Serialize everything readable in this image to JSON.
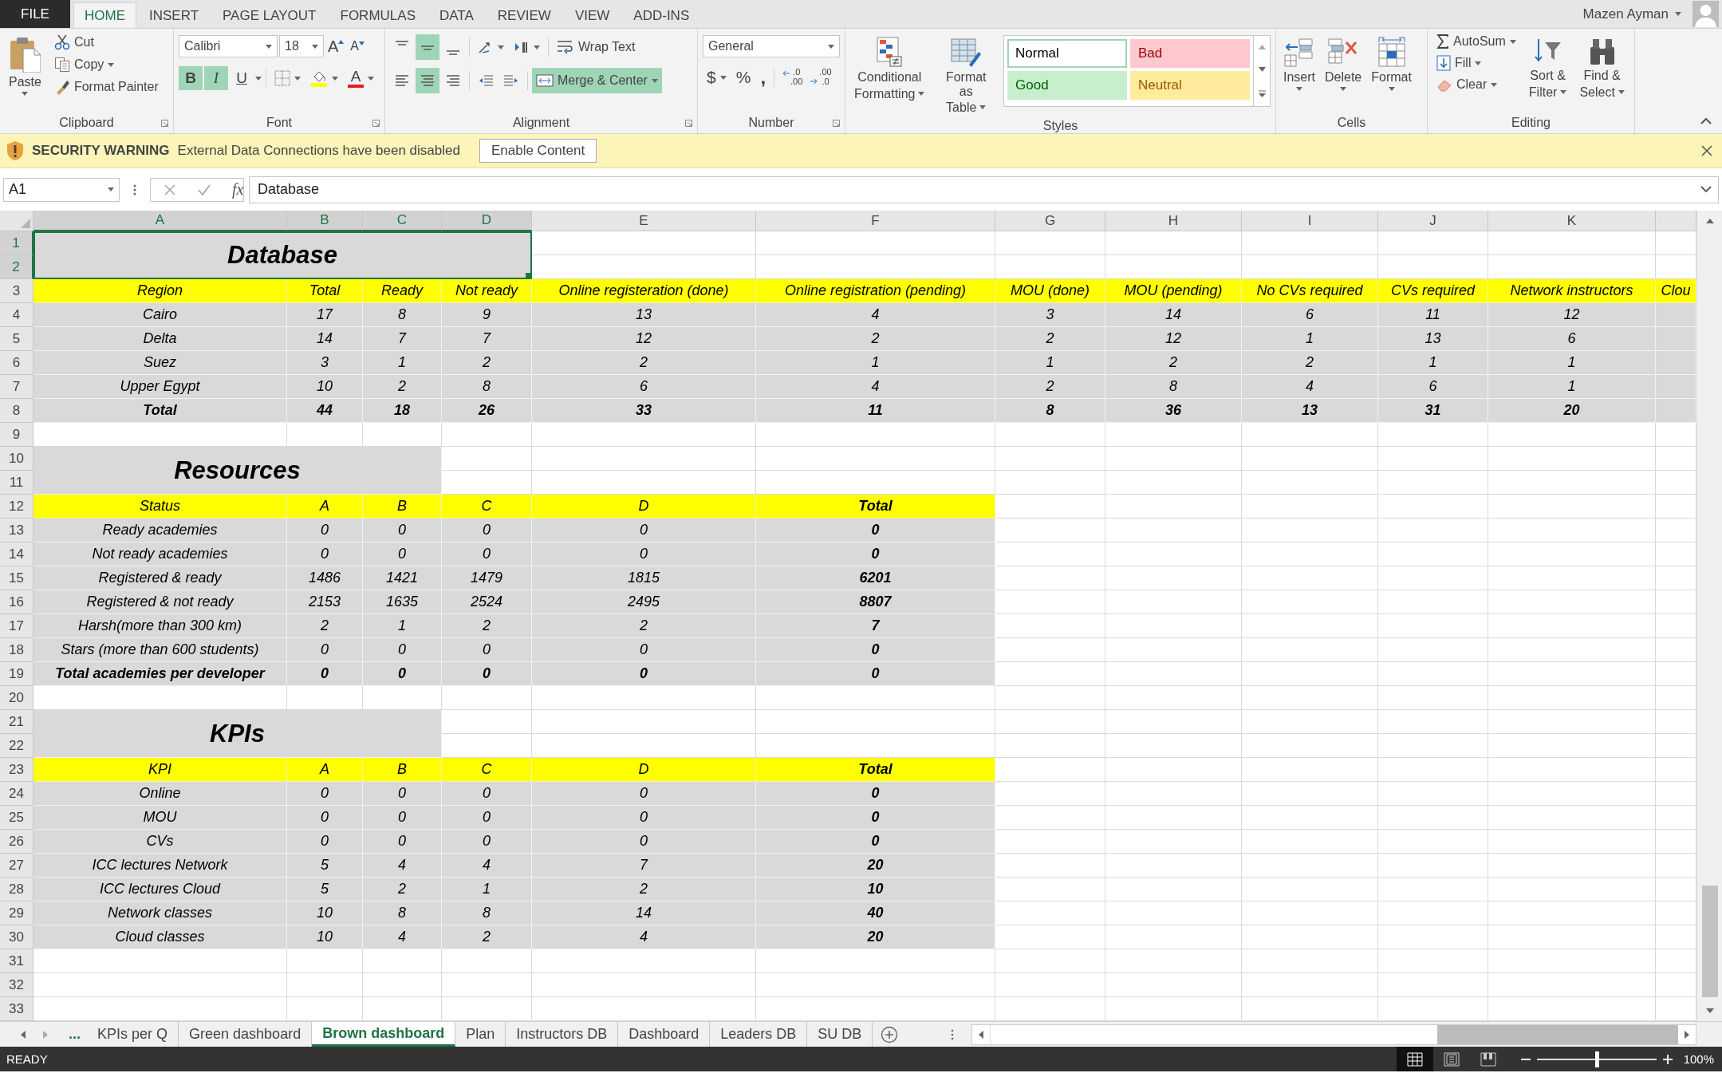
{
  "menu": {
    "file": "FILE",
    "tabs": [
      {
        "label": "HOME",
        "selected": true
      },
      {
        "label": "INSERT",
        "selected": false
      },
      {
        "label": "PAGE LAYOUT",
        "selected": false
      },
      {
        "label": "FORMULAS",
        "selected": false
      },
      {
        "label": "DATA",
        "selected": false
      },
      {
        "label": "REVIEW",
        "selected": false
      },
      {
        "label": "VIEW",
        "selected": false
      },
      {
        "label": "ADD-INS",
        "selected": false
      }
    ],
    "user": "Mazen Ayman"
  },
  "ribbon": {
    "clipboard": {
      "label": "Clipboard",
      "paste": "Paste",
      "cut": "Cut",
      "copy": "Copy",
      "format_painter": "Format Painter"
    },
    "font": {
      "label": "Font",
      "name": "Calibri",
      "size": "18",
      "grow": "A",
      "shrink": "A",
      "color_label": "A",
      "buttons": [
        {
          "kind": "bold",
          "label": "B",
          "on": true
        },
        {
          "kind": "italic",
          "label": "I",
          "on": true
        },
        {
          "kind": "underline",
          "label": "U",
          "on": false
        }
      ]
    },
    "alignment": {
      "label": "Alignment",
      "wrap_text": "Wrap Text",
      "merge_center": "Merge & Center",
      "merged": true,
      "vertical": [
        {
          "selected": false
        },
        {
          "selected": true
        },
        {
          "selected": false
        }
      ],
      "horizontal": [
        {
          "selected": false
        },
        {
          "selected": true
        },
        {
          "selected": false
        }
      ]
    },
    "number": {
      "label": "Number",
      "format": "General",
      "currency": "$",
      "percent": "%",
      "comma": ",",
      "decimals": [
        {
          "kind": "increase",
          "lines": [
            ".0",
            ".00"
          ]
        },
        {
          "kind": "decrease",
          "lines": [
            ".00",
            ".0"
          ]
        }
      ]
    },
    "styles": {
      "label": "Styles",
      "conditional": [
        "Conditional",
        "Formatting"
      ],
      "format_table": [
        "Format as",
        "Table"
      ],
      "gallery": [
        {
          "label": "Normal",
          "kind": "normal",
          "selected": true
        },
        {
          "label": "Bad",
          "kind": "bad",
          "selected": false
        },
        {
          "label": "Good",
          "kind": "good",
          "selected": false
        },
        {
          "label": "Neutral",
          "kind": "neutral",
          "selected": false
        }
      ]
    },
    "cells": {
      "label": "Cells",
      "buttons": [
        {
          "kind": "insert",
          "label": "Insert"
        },
        {
          "kind": "delete",
          "label": "Delete"
        },
        {
          "kind": "format",
          "label": "Format"
        }
      ]
    },
    "editing": {
      "label": "Editing",
      "autosum": "AutoSum",
      "fill": "Fill",
      "clear": "Clear",
      "sort_filter": [
        "Sort &",
        "Filter"
      ],
      "find_select": [
        "Find &",
        "Select"
      ]
    }
  },
  "security": {
    "title": "SECURITY WARNING",
    "message": "External Data Connections have been disabled",
    "button": "Enable Content"
  },
  "formula_bar": {
    "name_box": "A1",
    "fx": "fx",
    "formula": "Database"
  },
  "sheet": {
    "columns": [
      {
        "label": "A",
        "selected": true
      },
      {
        "label": "B",
        "selected": true
      },
      {
        "label": "C",
        "selected": true
      },
      {
        "label": "D",
        "selected": true
      },
      {
        "label": "E",
        "selected": false
      },
      {
        "label": "F",
        "selected": false
      },
      {
        "label": "G",
        "selected": false
      },
      {
        "label": "H",
        "selected": false
      },
      {
        "label": "I",
        "selected": false
      },
      {
        "label": "J",
        "selected": false
      },
      {
        "label": "K",
        "selected": false
      }
    ],
    "rows": [
      {
        "label": "1",
        "selected": true
      },
      {
        "label": "2",
        "selected": true
      },
      {
        "label": "3",
        "selected": false
      },
      {
        "label": "4",
        "selected": false
      },
      {
        "label": "5",
        "selected": false
      },
      {
        "label": "6",
        "selected": false
      },
      {
        "label": "7",
        "selected": false
      },
      {
        "label": "8",
        "selected": false
      },
      {
        "label": "9",
        "selected": false
      },
      {
        "label": "10",
        "selected": false
      },
      {
        "label": "11",
        "selected": false
      },
      {
        "label": "12",
        "selected": false
      },
      {
        "label": "13",
        "selected": false
      },
      {
        "label": "14",
        "selected": false
      },
      {
        "label": "15",
        "selected": false
      },
      {
        "label": "16",
        "selected": false
      },
      {
        "label": "17",
        "selected": false
      },
      {
        "label": "18",
        "selected": false
      },
      {
        "label": "19",
        "selected": false
      },
      {
        "label": "20",
        "selected": false
      },
      {
        "label": "21",
        "selected": false
      },
      {
        "label": "22",
        "selected": false
      },
      {
        "label": "23",
        "selected": false
      },
      {
        "label": "24",
        "selected": false
      },
      {
        "label": "25",
        "selected": false
      },
      {
        "label": "26",
        "selected": false
      },
      {
        "label": "27",
        "selected": false
      },
      {
        "label": "28",
        "selected": false
      },
      {
        "label": "29",
        "selected": false
      },
      {
        "label": "30",
        "selected": false
      },
      {
        "label": "31",
        "selected": false
      },
      {
        "label": "32",
        "selected": false
      },
      {
        "label": "33",
        "selected": false
      }
    ],
    "sections": [
      {
        "title": "Database",
        "total_column": false,
        "header": [
          "Region",
          "Total",
          "Ready",
          "Not ready",
          "Online registeration (done)",
          "Online registration (pending)",
          "MOU (done)",
          "MOU (pending)",
          "No CVs required",
          "CVs required",
          "Network instructors",
          "Clou"
        ],
        "rows": [
          [
            "Cairo",
            "17",
            "8",
            "9",
            "13",
            "4",
            "3",
            "14",
            "6",
            "11",
            "12"
          ],
          [
            "Delta",
            "14",
            "7",
            "7",
            "12",
            "2",
            "2",
            "12",
            "1",
            "13",
            "6"
          ],
          [
            "Suez",
            "3",
            "1",
            "2",
            "2",
            "1",
            "1",
            "2",
            "2",
            "1",
            "1"
          ],
          [
            "Upper Egypt",
            "10",
            "2",
            "8",
            "6",
            "4",
            "2",
            "8",
            "4",
            "6",
            "1"
          ]
        ],
        "total": [
          "Total",
          "44",
          "18",
          "26",
          "33",
          "11",
          "8",
          "36",
          "13",
          "31",
          "20"
        ]
      },
      {
        "title": "Resources",
        "total_column": true,
        "header": [
          "Status",
          "A",
          "B",
          "C",
          "D",
          "Total"
        ],
        "rows": [
          [
            "Ready academies",
            "0",
            "0",
            "0",
            "0",
            "0"
          ],
          [
            "Not ready academies",
            "0",
            "0",
            "0",
            "0",
            "0"
          ],
          [
            "Registered & ready",
            "1486",
            "1421",
            "1479",
            "1815",
            "6201"
          ],
          [
            "Registered & not ready",
            "2153",
            "1635",
            "2524",
            "2495",
            "8807"
          ],
          [
            "Harsh(more than 300 km)",
            "2",
            "1",
            "2",
            "2",
            "7"
          ],
          [
            "Stars (more than 600 students)",
            "0",
            "0",
            "0",
            "0",
            "0"
          ]
        ],
        "total": [
          "Total academies per developer",
          "0",
          "0",
          "0",
          "0",
          "0"
        ]
      },
      {
        "title": "KPIs",
        "total_column": true,
        "header": [
          "KPI",
          "A",
          "B",
          "C",
          "D",
          "Total"
        ],
        "rows": [
          [
            "Online",
            "0",
            "0",
            "0",
            "0",
            "0"
          ],
          [
            "MOU",
            "0",
            "0",
            "0",
            "0",
            "0"
          ],
          [
            "CVs",
            "0",
            "0",
            "0",
            "0",
            "0"
          ],
          [
            "ICC lectures Network",
            "5",
            "4",
            "4",
            "7",
            "20"
          ],
          [
            "ICC lectures Cloud",
            "5",
            "2",
            "1",
            "2",
            "10"
          ],
          [
            "Network classes",
            "10",
            "8",
            "8",
            "14",
            "40"
          ],
          [
            "Cloud classes",
            "10",
            "4",
            "2",
            "4",
            "20"
          ]
        ]
      }
    ]
  },
  "sheet_tabs": {
    "more": "...",
    "tabs": [
      {
        "label": "KPIs per Q",
        "selected": false
      },
      {
        "label": "Green dashboard",
        "selected": false
      },
      {
        "label": "Brown dashboard",
        "selected": true
      },
      {
        "label": "Plan",
        "selected": false
      },
      {
        "label": "Instructors DB",
        "selected": false
      },
      {
        "label": "Dashboard",
        "selected": false
      },
      {
        "label": "Leaders DB",
        "selected": false
      },
      {
        "label": "SU DB",
        "selected": false
      }
    ]
  },
  "status": {
    "text": "READY",
    "views": [
      {
        "selected": true
      },
      {
        "selected": false
      },
      {
        "selected": false
      }
    ],
    "zoom": {
      "level": 0.5,
      "reading": "100%"
    }
  }
}
